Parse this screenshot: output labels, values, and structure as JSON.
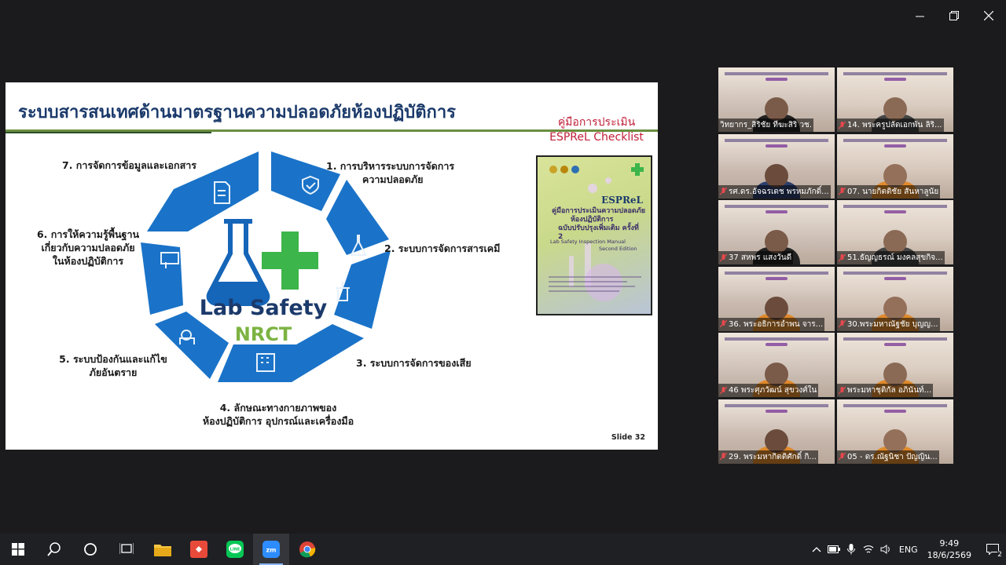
{
  "window": {
    "min_icon": "minimize-icon",
    "max_icon": "restore-icon",
    "close_icon": "close-icon"
  },
  "slide": {
    "title": "ระบบสารสนเทศด้านมาตรฐานความปลอดภัยห้องปฏิบัติการ",
    "items": {
      "i1": [
        "1. การบริหารระบบการจัดการ",
        "ความปลอดภัย"
      ],
      "i2": [
        "2. ระบบการจัดการสารเคมี"
      ],
      "i3": [
        "3. ระบบการจัดการของเสีย"
      ],
      "i4": [
        "4. ลักษณะทางกายภาพของ",
        "ห้องปฏิบัติการ อุปกรณ์และเครื่องมือ"
      ],
      "i5": [
        "5. ระบบป้องกันและแก้ไข",
        "ภัยอันตราย"
      ],
      "i6": [
        "6. การให้ความรู้พื้นฐาน",
        "เกี่ยวกับความปลอดภัย",
        "ในห้องปฏิบัติการ"
      ],
      "i7": [
        "7. การจัดการข้อมูลและเอกสาร"
      ]
    },
    "logo": {
      "line1": "Lab Safety",
      "line2": "NRCT"
    },
    "manual": {
      "line1": "คู่มือการประเมิน",
      "line2": "ESPReL Checklist"
    },
    "book": {
      "brand": "ESPReL",
      "title1": "คู่มือการประเมินความปลอดภัย",
      "title2": "ห้องปฏิบัติการ",
      "title3": "ฉบับปรับปรุงเพิ่มเติม ครั้งที่ 2",
      "en1": "Lab Safety Inspection Manual",
      "en2": "Second Edition"
    },
    "slide_no": "Slide 32"
  },
  "participants": [
    {
      "name": "วิทยากร_สิริชัย ทีฆะสิริ วช.",
      "active": true,
      "muted": false
    },
    {
      "name": "14. พระครูปลัดเอกพัน ลิริ...",
      "active": false,
      "muted": true
    },
    {
      "name": "รศ.ดร.อัจฉรเดช พรหมภักดิ์...",
      "active": false,
      "muted": true
    },
    {
      "name": "07. นายกิตติชัย สันหาลูนัย",
      "active": false,
      "muted": true
    },
    {
      "name": "37 สหพร แสงวันดี",
      "active": false,
      "muted": true
    },
    {
      "name": "51.ธัญญธรณ์ มงคลสุขกิจ...",
      "active": false,
      "muted": true
    },
    {
      "name": "36. พระอธิการอำพน จาร...",
      "active": false,
      "muted": true
    },
    {
      "name": "30.พระมหาณัฐชัย บุญญ...",
      "active": false,
      "muted": true
    },
    {
      "name": "46 พระศุภวัฒน์ สุขวงศ์ใน",
      "active": false,
      "muted": true
    },
    {
      "name": "พระมหาชุติกัล อภินันท์...",
      "active": false,
      "muted": true
    },
    {
      "name": "29. พระมหากิตติศักดิ์ กิ...",
      "active": false,
      "muted": true
    },
    {
      "name": "05 - ดร.ณัฐนิชา ปัญญิน...",
      "active": false,
      "muted": true
    }
  ],
  "taskbar": {
    "apps": [
      "windows-start-icon",
      "search-icon",
      "cortana-icon",
      "task-view-icon",
      "file-explorer-icon",
      "anydesk-icon",
      "line-icon",
      "zoom-icon",
      "chrome-icon"
    ],
    "lang": "ENG",
    "time": "9:49",
    "date": "18/6/2569",
    "notifications": "2"
  },
  "colors": {
    "accent": "#1a73c8",
    "green": "#3cb54a",
    "title": "#1b3a6b"
  }
}
